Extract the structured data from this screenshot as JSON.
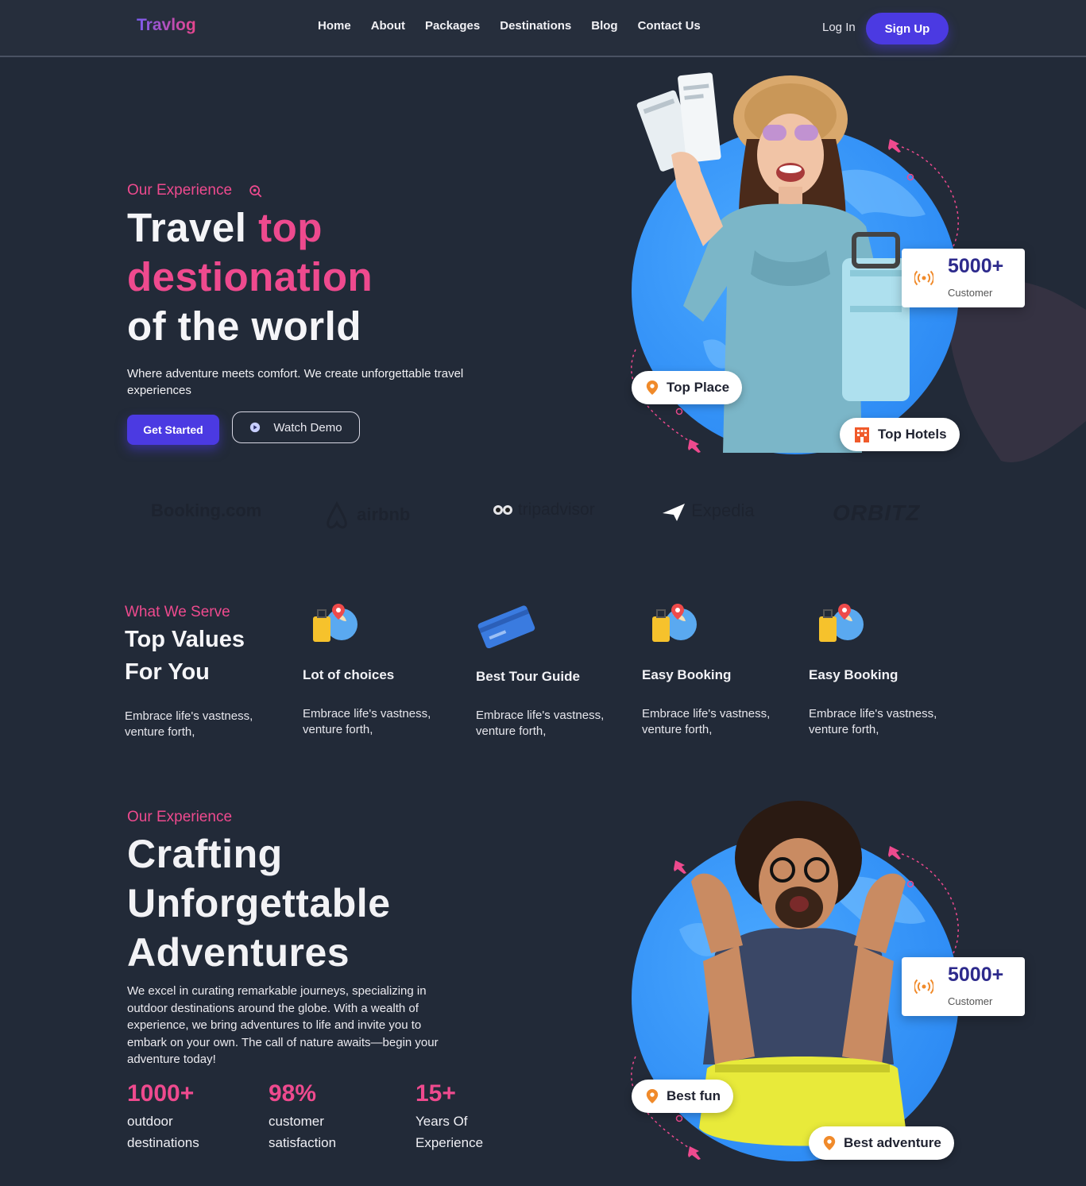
{
  "nav": {
    "logo": "Travlog",
    "links": [
      "Home",
      "About",
      "Packages",
      "Destinations",
      "Blog",
      "Contact Us"
    ],
    "login": "Log In",
    "signup": "Sign Up"
  },
  "hero": {
    "eyebrow": "Our Experience",
    "title_part1": "Travel ",
    "title_part2": "top",
    "title_part3": "destionation",
    "title_part4": "of the world",
    "description": "Where adventure meets comfort. We create unforgettable travel experiences",
    "cta_primary": "Get Started",
    "cta_secondary": "Watch Demo",
    "stat_value": "5000+",
    "stat_label": "Customer",
    "pill_top_place": "Top Place",
    "pill_top_hotels": "Top Hotels"
  },
  "partners": [
    "Booking.com",
    "airbnb",
    "tripadvisor",
    "Expedia",
    "ORBITZ"
  ],
  "serve": {
    "eyebrow": "What We Serve",
    "title": "Top Values For You",
    "description": "Embrace life's vastness, venture forth,",
    "features": [
      {
        "title": "Lot of choices",
        "description": "Embrace life's vastness, venture forth,",
        "icon": "luggage-globe-icon"
      },
      {
        "title": "Best Tour Guide",
        "description": "Embrace life's vastness, venture forth,",
        "icon": "credit-card-icon"
      },
      {
        "title": "Easy Booking",
        "description": "Embrace life's vastness, venture forth,",
        "icon": "luggage-globe-icon"
      },
      {
        "title": "Easy Booking",
        "description": "Embrace life's vastness, venture forth,",
        "icon": "luggage-globe-icon"
      }
    ]
  },
  "experience": {
    "eyebrow": "Our Experience",
    "title": "Crafting Unforgettable Adventures",
    "description": "We excel in curating remarkable journeys, specializing in outdoor destinations around the globe. With a wealth of experience, we bring adventures to life and invite you to embark on your own. The call of nature awaits—begin your adventure today!",
    "metrics": [
      {
        "value": "1000+",
        "label": "outdoor destinations"
      },
      {
        "value": "98%",
        "label": "customer satisfaction"
      },
      {
        "value": "15+",
        "label": "Years Of Experience"
      }
    ],
    "stat_value": "5000+",
    "stat_label": "Customer",
    "pill_best_fun": "Best fun",
    "pill_best_adventure": "Best adventure"
  },
  "colors": {
    "background": "#222a38",
    "accent_pink": "#ee4a8e",
    "accent_purple": "#4b3ae2",
    "globe_blue": "#2f8df5"
  }
}
